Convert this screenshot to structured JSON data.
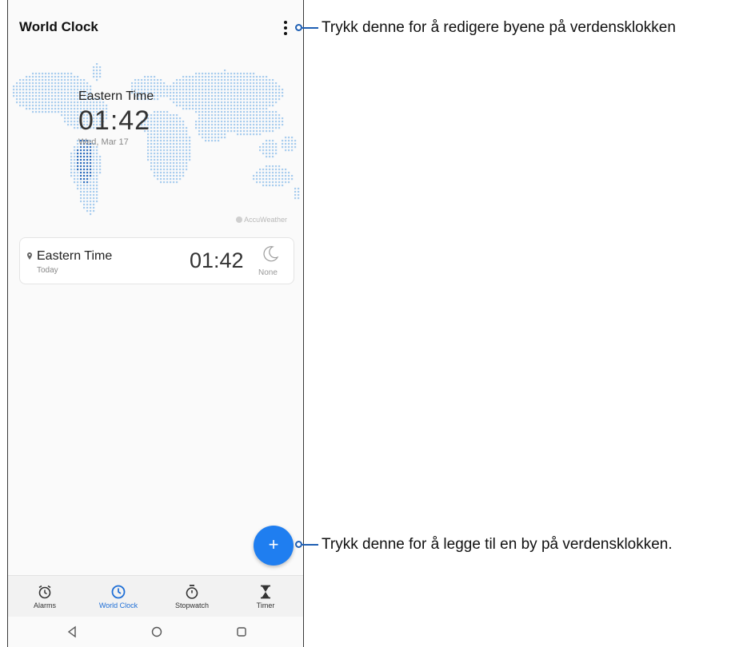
{
  "app": {
    "title": "World Clock"
  },
  "map": {
    "zone_name": "Eastern Time",
    "time": "01:42",
    "date": "Wed, Mar 17",
    "credit": "AccuWeather"
  },
  "cities": [
    {
      "name": "Eastern Time",
      "day": "Today",
      "time": "01:42",
      "weather_label": "None",
      "weather_icon": "moon-icon"
    }
  ],
  "bottom_nav": {
    "items": [
      {
        "label": "Alarms",
        "icon": "alarm-clock-icon",
        "active": false
      },
      {
        "label": "World Clock",
        "icon": "clock-icon",
        "active": true
      },
      {
        "label": "Stopwatch",
        "icon": "stopwatch-icon",
        "active": false
      },
      {
        "label": "Timer",
        "icon": "hourglass-icon",
        "active": false
      }
    ]
  },
  "fab": {
    "symbol": "+"
  },
  "callouts": {
    "menu": "Trykk denne for å redigere byene på verdensklokken",
    "add": "Trykk denne for å legge til en by på verdensklokken."
  },
  "colors": {
    "accent": "#1f7ef0",
    "map_dot": "#a9cdee",
    "map_highlight": "#2f6fbf",
    "callout_line": "#1f5fb3"
  }
}
